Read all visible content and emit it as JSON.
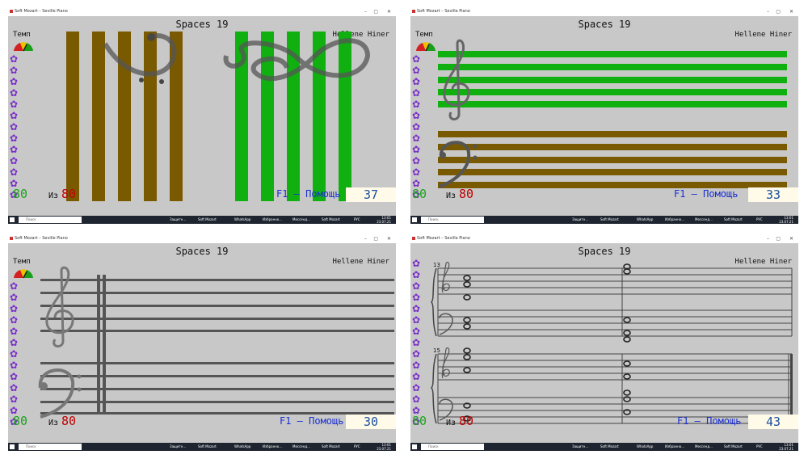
{
  "app": {
    "title": "Soft Mozart – Seville Piano"
  },
  "window_controls": {
    "minimize": "–",
    "maximize": "▢",
    "close": "✕"
  },
  "screens": [
    {
      "title": "Spaces 19",
      "composer": "Hellene Hiner",
      "tempo": "Темп",
      "score": "80",
      "of": "Из",
      "total": "80",
      "help": "F1 – Помощь",
      "counter": "37"
    },
    {
      "title": "Spaces 19",
      "composer": "Hellene Hiner",
      "tempo": "Темп",
      "score": "80",
      "of": "Из",
      "total": "80",
      "help": "F1 – Помощь",
      "counter": "33"
    },
    {
      "title": "Spaces 19",
      "composer": "Hellene Hiner",
      "tempo": "Темп",
      "score": "80",
      "of": "Из",
      "total": "80",
      "help": "F1 – Помощь",
      "counter": "30"
    },
    {
      "title": "Spaces 19",
      "composer": "Hellene Hiner",
      "tempo": "Темп",
      "score": "80",
      "of": "Из",
      "total": "80",
      "help": "F1 – Помощь",
      "counter": "43"
    }
  ],
  "measure_numbers": [
    "13",
    "15"
  ],
  "taskbar": {
    "search_placeholder": "Поиск",
    "items": [
      "Защитн...",
      "Soft Mozart",
      "WhatsApp",
      "Избранно...",
      "Мессенд...",
      "Soft Mozart"
    ],
    "language": "РУС",
    "clock_time": "13:01",
    "clock_date": "23.07.21"
  },
  "colors": {
    "brown": "#7a5a00",
    "green": "#10b010",
    "staff_gray": "#555555",
    "score_green": "#1aa31a",
    "total_red": "#c00000",
    "help_blue": "#1a2fd0",
    "flower_purple": "#7a2fc9"
  }
}
